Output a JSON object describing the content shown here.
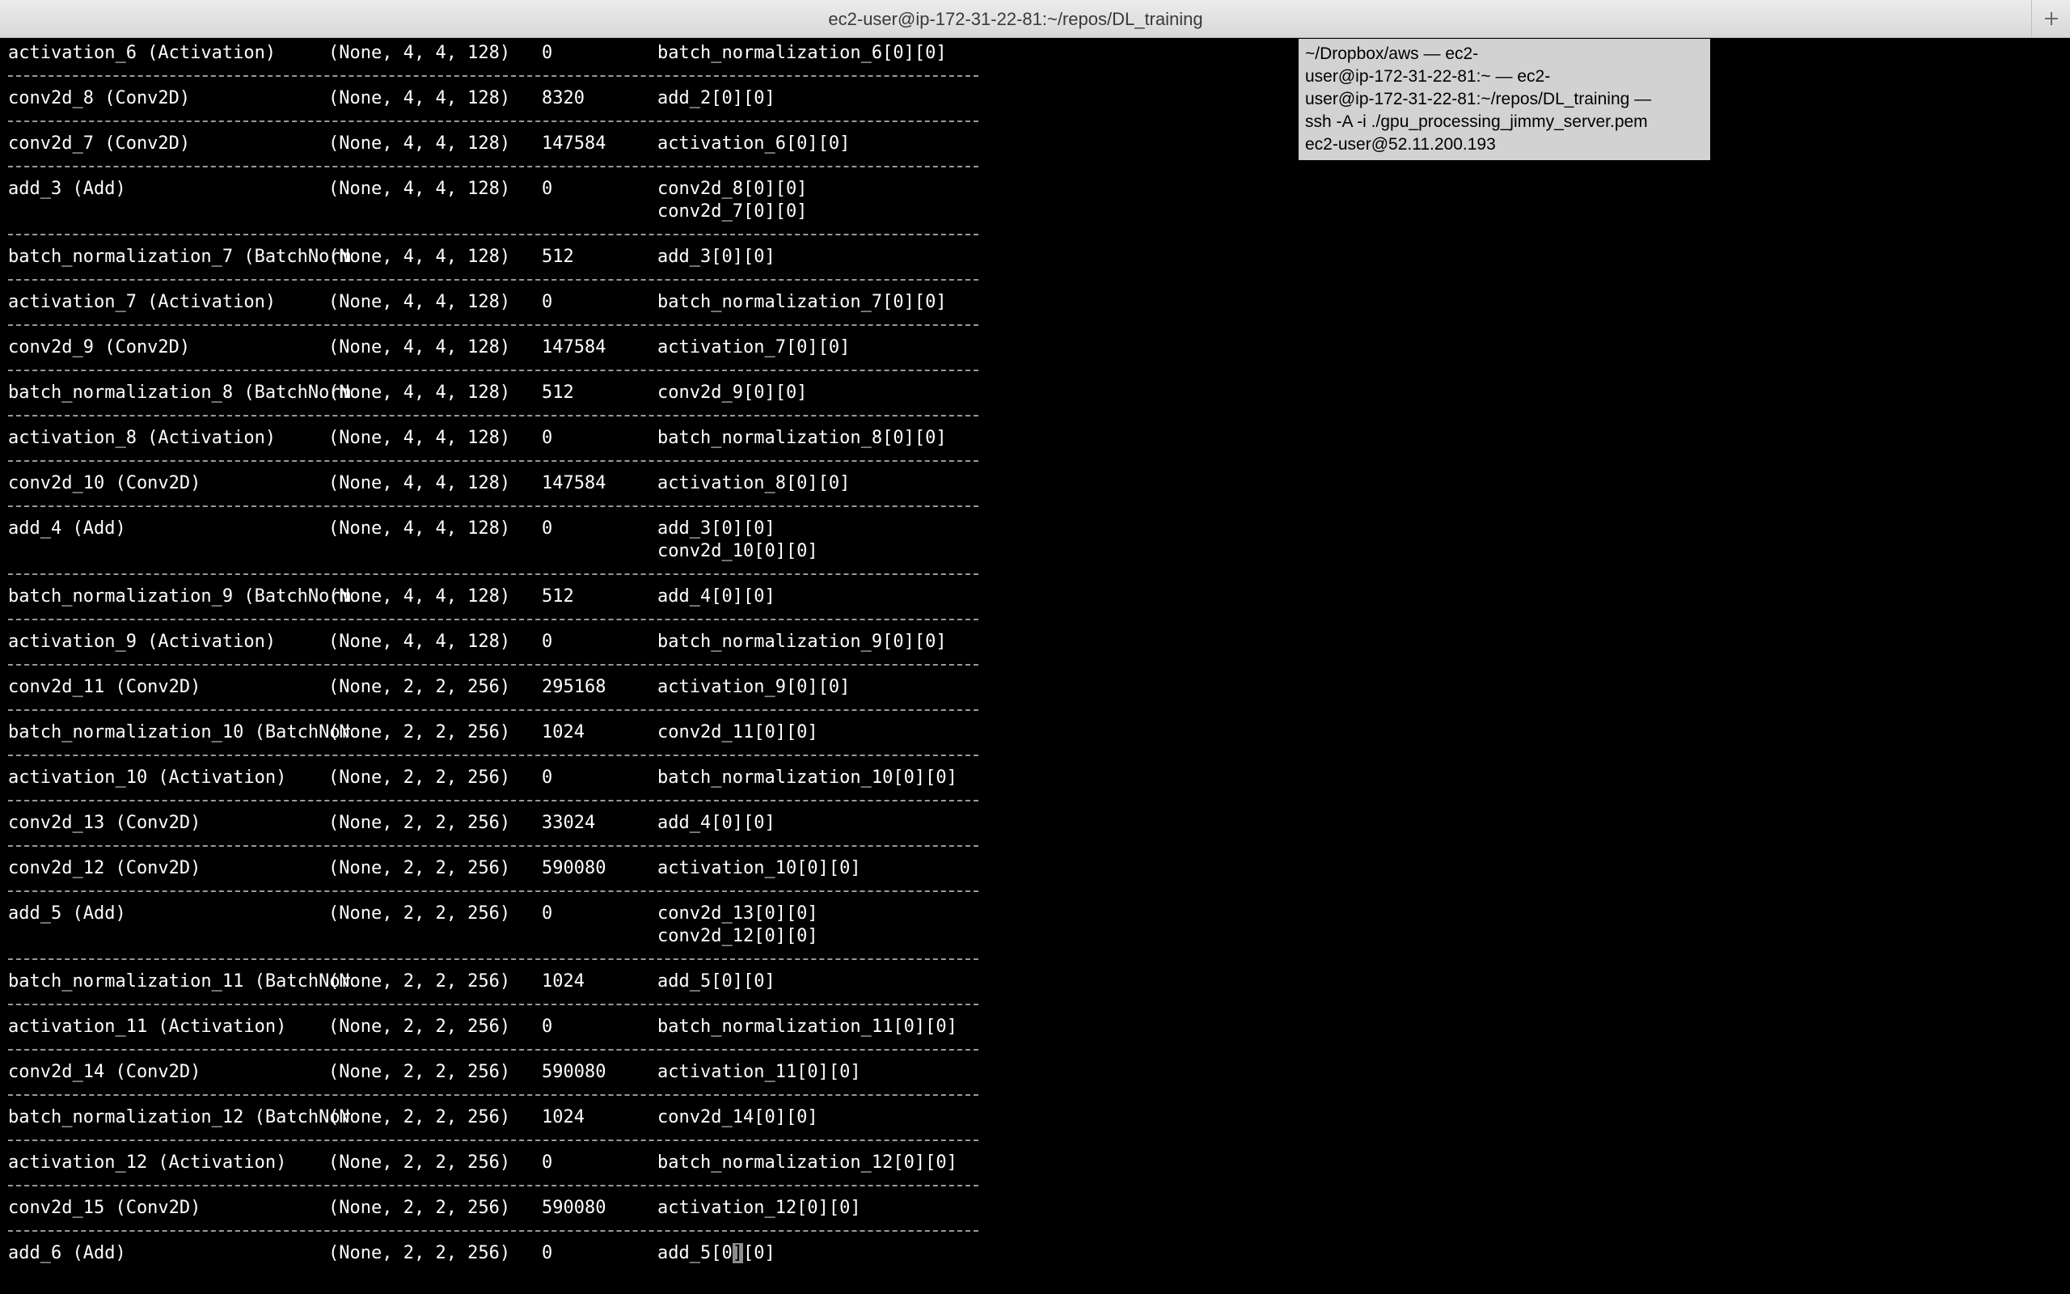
{
  "window": {
    "title": "ec2-user@ip-172-31-22-81:~/repos/DL_training",
    "new_tab_icon": "plus-icon"
  },
  "tooltip": {
    "lines": [
      "~/Dropbox/aws — ec2-",
      "user@ip-172-31-22-81:~ — ec2-",
      "user@ip-172-31-22-81:~/repos/DL_training —",
      "ssh -A -i ./gpu_processing_jimmy_server.pem",
      "ec2-user@52.11.200.193"
    ]
  },
  "terminal": {
    "rows": [
      {
        "layer": "activation_6 (Activation)",
        "shape": "(None, 4, 4, 128)",
        "params": "0",
        "connected": [
          "batch_normalization_6[0][0]"
        ]
      },
      {
        "layer": "conv2d_8 (Conv2D)",
        "shape": "(None, 4, 4, 128)",
        "params": "8320",
        "connected": [
          "add_2[0][0]"
        ]
      },
      {
        "layer": "conv2d_7 (Conv2D)",
        "shape": "(None, 4, 4, 128)",
        "params": "147584",
        "connected": [
          "activation_6[0][0]"
        ]
      },
      {
        "layer": "add_3 (Add)",
        "shape": "(None, 4, 4, 128)",
        "params": "0",
        "connected": [
          "conv2d_8[0][0]",
          "conv2d_7[0][0]"
        ]
      },
      {
        "layer": "batch_normalization_7 (BatchNorm",
        "shape": "(None, 4, 4, 128)",
        "params": "512",
        "connected": [
          "add_3[0][0]"
        ]
      },
      {
        "layer": "activation_7 (Activation)",
        "shape": "(None, 4, 4, 128)",
        "params": "0",
        "connected": [
          "batch_normalization_7[0][0]"
        ]
      },
      {
        "layer": "conv2d_9 (Conv2D)",
        "shape": "(None, 4, 4, 128)",
        "params": "147584",
        "connected": [
          "activation_7[0][0]"
        ]
      },
      {
        "layer": "batch_normalization_8 (BatchNorm",
        "shape": "(None, 4, 4, 128)",
        "params": "512",
        "connected": [
          "conv2d_9[0][0]"
        ]
      },
      {
        "layer": "activation_8 (Activation)",
        "shape": "(None, 4, 4, 128)",
        "params": "0",
        "connected": [
          "batch_normalization_8[0][0]"
        ]
      },
      {
        "layer": "conv2d_10 (Conv2D)",
        "shape": "(None, 4, 4, 128)",
        "params": "147584",
        "connected": [
          "activation_8[0][0]"
        ]
      },
      {
        "layer": "add_4 (Add)",
        "shape": "(None, 4, 4, 128)",
        "params": "0",
        "connected": [
          "add_3[0][0]",
          "conv2d_10[0][0]"
        ]
      },
      {
        "layer": "batch_normalization_9 (BatchNorm",
        "shape": "(None, 4, 4, 128)",
        "params": "512",
        "connected": [
          "add_4[0][0]"
        ]
      },
      {
        "layer": "activation_9 (Activation)",
        "shape": "(None, 4, 4, 128)",
        "params": "0",
        "connected": [
          "batch_normalization_9[0][0]"
        ]
      },
      {
        "layer": "conv2d_11 (Conv2D)",
        "shape": "(None, 2, 2, 256)",
        "params": "295168",
        "connected": [
          "activation_9[0][0]"
        ]
      },
      {
        "layer": "batch_normalization_10 (BatchNor",
        "shape": "(None, 2, 2, 256)",
        "params": "1024",
        "connected": [
          "conv2d_11[0][0]"
        ]
      },
      {
        "layer": "activation_10 (Activation)",
        "shape": "(None, 2, 2, 256)",
        "params": "0",
        "connected": [
          "batch_normalization_10[0][0]"
        ]
      },
      {
        "layer": "conv2d_13 (Conv2D)",
        "shape": "(None, 2, 2, 256)",
        "params": "33024",
        "connected": [
          "add_4[0][0]"
        ]
      },
      {
        "layer": "conv2d_12 (Conv2D)",
        "shape": "(None, 2, 2, 256)",
        "params": "590080",
        "connected": [
          "activation_10[0][0]"
        ]
      },
      {
        "layer": "add_5 (Add)",
        "shape": "(None, 2, 2, 256)",
        "params": "0",
        "connected": [
          "conv2d_13[0][0]",
          "conv2d_12[0][0]"
        ]
      },
      {
        "layer": "batch_normalization_11 (BatchNor",
        "shape": "(None, 2, 2, 256)",
        "params": "1024",
        "connected": [
          "add_5[0][0]"
        ]
      },
      {
        "layer": "activation_11 (Activation)",
        "shape": "(None, 2, 2, 256)",
        "params": "0",
        "connected": [
          "batch_normalization_11[0][0]"
        ]
      },
      {
        "layer": "conv2d_14 (Conv2D)",
        "shape": "(None, 2, 2, 256)",
        "params": "590080",
        "connected": [
          "activation_11[0][0]"
        ]
      },
      {
        "layer": "batch_normalization_12 (BatchNor",
        "shape": "(None, 2, 2, 256)",
        "params": "1024",
        "connected": [
          "conv2d_14[0][0]"
        ]
      },
      {
        "layer": "activation_12 (Activation)",
        "shape": "(None, 2, 2, 256)",
        "params": "0",
        "connected": [
          "batch_normalization_12[0][0]"
        ]
      },
      {
        "layer": "conv2d_15 (Conv2D)",
        "shape": "(None, 2, 2, 256)",
        "params": "590080",
        "connected": [
          "activation_12[0][0]"
        ]
      },
      {
        "layer": "add_6 (Add)",
        "shape": "(None, 2, 2, 256)",
        "params": "0",
        "connected": [
          "add_5[0][0]"
        ]
      }
    ],
    "cursor": {
      "row": 25,
      "line": 0,
      "char_index": 7
    }
  }
}
